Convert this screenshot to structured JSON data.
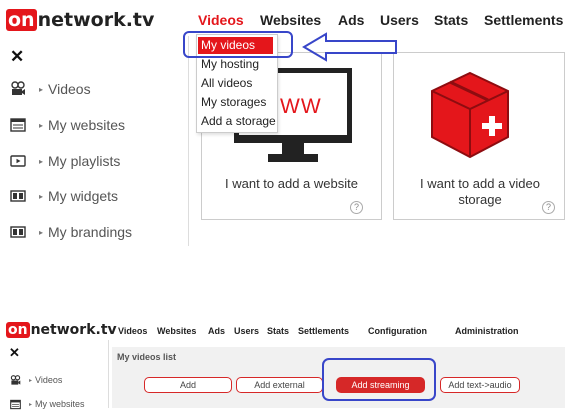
{
  "top": {
    "logo": {
      "prefix": "on",
      "rest": "network.tv"
    },
    "close": "✕",
    "tabs": [
      "Videos",
      "Websites",
      "Ads",
      "Users",
      "Stats",
      "Settlements"
    ],
    "dropdown": [
      "My videos",
      "My hosting",
      "All videos",
      "My storages",
      "Add a storage"
    ],
    "sidebar": [
      "Videos",
      "My websites",
      "My playlists",
      "My widgets",
      "My brandings"
    ],
    "card_website": {
      "label": "I want to add a website",
      "screen_text": "WW",
      "help": "?"
    },
    "card_storage": {
      "label": "I want to add a video storage",
      "help": "?"
    }
  },
  "bottom": {
    "logo": {
      "prefix": "on",
      "rest": "network.tv"
    },
    "close": "✕",
    "tabs": [
      "Videos",
      "Websites",
      "Ads",
      "Users",
      "Stats",
      "Settlements",
      "Configuration",
      "Administration"
    ],
    "sidebar": [
      "Videos",
      "My websites"
    ],
    "list_title": "My videos list",
    "buttons": {
      "add": "Add",
      "add_external": "Add external",
      "add_streaming": "Add streaming",
      "add_text_audio": "Add text->audio"
    }
  },
  "colors": {
    "brand_red": "#e4161b",
    "highlight_blue": "#3846c9"
  }
}
